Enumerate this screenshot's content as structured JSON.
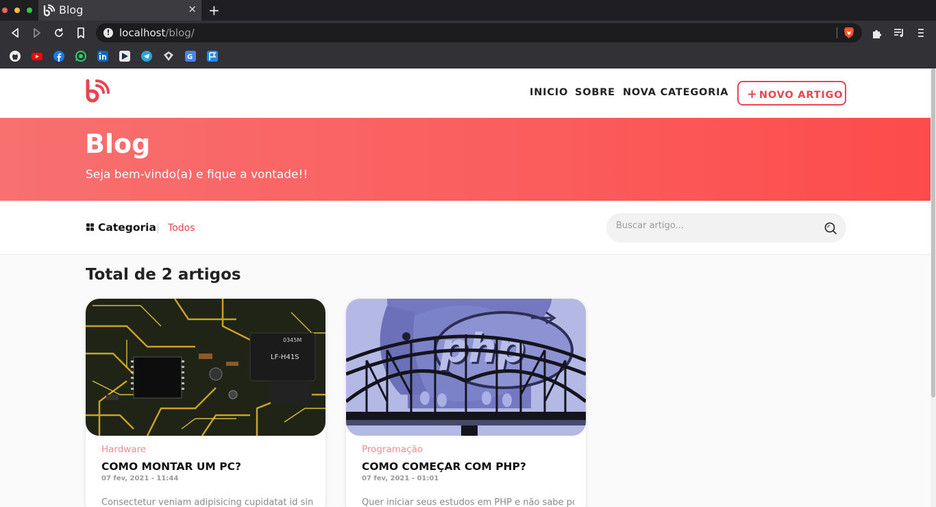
{
  "browser": {
    "tab_title": "Blog",
    "tab_close": "×",
    "new_tab": "+",
    "url_host": "localhost",
    "url_path": "/blog/",
    "bookmarks": [
      "github-icon",
      "youtube-icon",
      "facebook-icon",
      "whatsapp-icon",
      "linkedin-icon",
      "google-play-icon",
      "telegram-icon",
      "sourcetree-icon",
      "google-translate-icon",
      "flag-icon"
    ]
  },
  "nav": {
    "links": [
      "INICIO",
      "SOBRE",
      "NOVA CATEGORIA"
    ],
    "new_button": "NOVO ARTIGO",
    "new_button_icon": "+"
  },
  "hero": {
    "title": "Blog",
    "subtitle": "Seja bem-vindo(a) e fique a vontade!!"
  },
  "filter": {
    "category_label": "Categoria",
    "selected": "Todos",
    "search_placeholder": "Buscar artigo..."
  },
  "main": {
    "total": "Total de 2 artigos"
  },
  "articles": [
    {
      "category": "Hardware",
      "title": "COMO MONTAR UM PC?",
      "date": "07 fev, 2021 - 11:44",
      "excerpt": "Consectetur veniam adipisicing cupidatat id sint",
      "image": "circuit-board"
    },
    {
      "category": "Programação",
      "title": "COMO COMEÇAR COM PHP?",
      "date": "07 fev, 2021 - 01:01",
      "excerpt": "Quer iniciar seus estudos em PHP e não sabe por",
      "image": "php-elephant-bridge"
    }
  ],
  "colors": {
    "accent": "#e94452",
    "hero_start": "#f87070",
    "hero_end": "#fd4b4b",
    "category_text": "#f28a92"
  }
}
